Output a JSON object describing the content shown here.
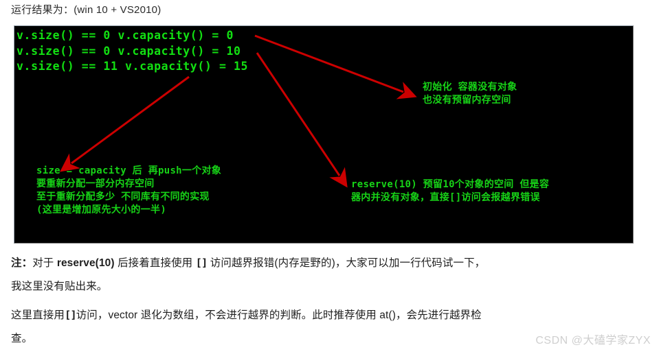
{
  "intro": {
    "text": "运行结果为：(win 10 + VS2010)"
  },
  "console": {
    "background_color": "#000000",
    "text_color": "#12e012",
    "output_lines": "v.size() == 0 v.capacity() = 0\nv.size() == 0 v.capacity() = 10\nv.size() == 11 v.capacity() = 15",
    "annotations": {
      "init_note": "初始化 容器没有对象\n也没有预留内存空间",
      "grow_note": "size = capacity 后 再push一个对象\n要重新分配一部分内存空间\n至于重新分配多少 不同库有不同的实现\n(这里是增加原先大小的一半)",
      "reserve_note": "reserve(10) 预留10个对象的空间 但是容\n器内并没有对象，直接[]访问会报越界错误"
    },
    "arrow_color": "#cc0000"
  },
  "notes": {
    "note_label": "注：",
    "para1_part1": "对于 ",
    "para1_bold1": "reserve(10)",
    "para1_part2": " 后接着直接使用 ",
    "para1_bracket": "[]",
    "para1_part3": " 访问越界报错(内存是野的)，大家可以加一行代码试一下，",
    "para1_line2": "我这里没有贴出来。",
    "para2_part1": "这里直接用",
    "para2_bracket": "[]",
    "para2_part2": "访问，vector 退化为数组，不会进行越界的判断。此时推荐使用 at()，会先进行越界检",
    "para2_line2": "查。"
  },
  "watermark": {
    "text": "CSDN @大磕学家ZYX"
  }
}
